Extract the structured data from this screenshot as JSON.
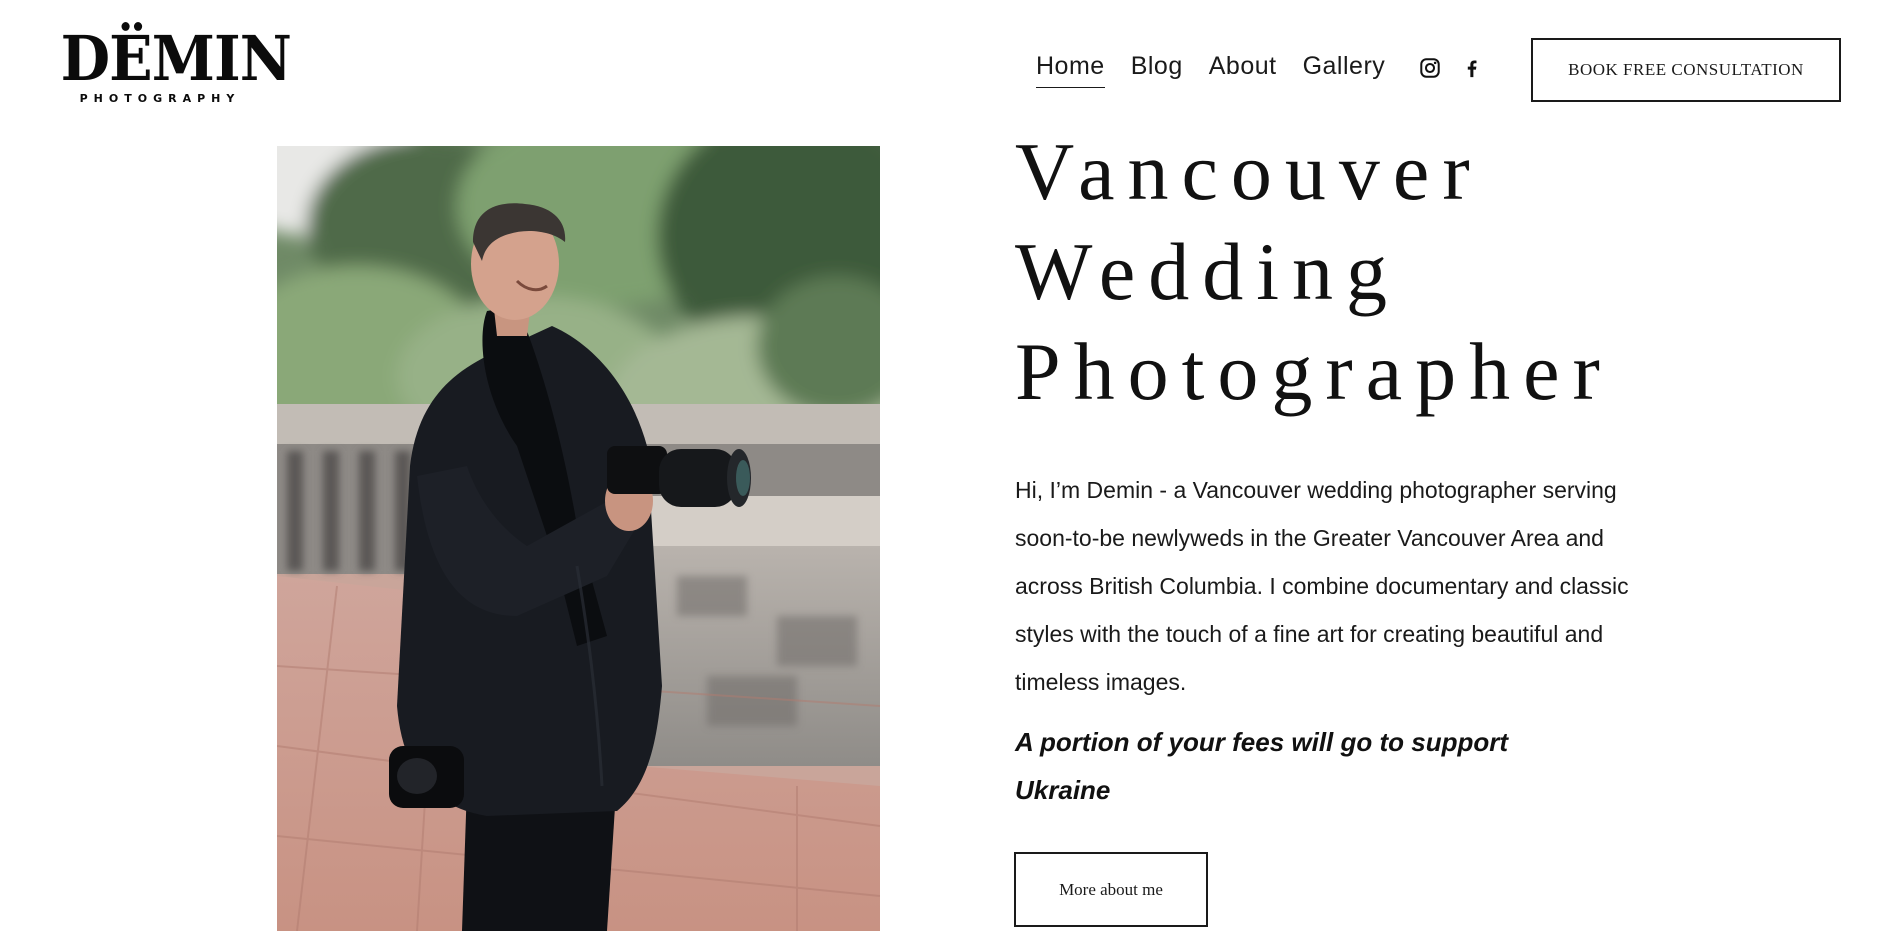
{
  "brand": {
    "name": "DËMIN",
    "tagline": "PHOTOGRAPHY"
  },
  "nav": {
    "items": [
      {
        "label": "Home",
        "active": true
      },
      {
        "label": "Blog",
        "active": false
      },
      {
        "label": "About",
        "active": false
      },
      {
        "label": "Gallery",
        "active": false
      }
    ]
  },
  "social": {
    "icons": [
      "instagram-icon",
      "facebook-icon"
    ]
  },
  "header": {
    "cta_label": "BOOK FREE CONSULTATION"
  },
  "hero": {
    "title_lines": [
      "Vancouver",
      "Wedding",
      "Photographer"
    ],
    "bio": "Hi, I’m Demin - a Vancouver wedding photographer serving soon-to-be newlyweds in the Greater Vancouver Area and across British Columbia. I combine documentary and classic styles with the touch of a fine art for creating beautiful and timeless images.",
    "support_note": "A portion of your fees will go to support Ukraine",
    "more_label": "More about me"
  },
  "colors": {
    "text": "#111111",
    "background": "#ffffff"
  }
}
